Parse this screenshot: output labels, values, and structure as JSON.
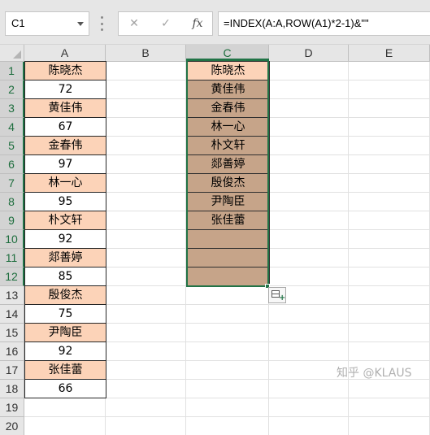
{
  "name_box": {
    "value": "C1"
  },
  "formula_bar": {
    "cancel_icon": "✕",
    "enter_icon": "✓",
    "fx_label": "fx",
    "formula": "=INDEX(A:A,ROW(A1)*2-1)&\"\""
  },
  "columns": [
    "A",
    "B",
    "C",
    "D",
    "E"
  ],
  "rows": [
    "1",
    "2",
    "3",
    "4",
    "5",
    "6",
    "7",
    "8",
    "9",
    "10",
    "11",
    "12",
    "13",
    "14",
    "15",
    "16",
    "17",
    "18",
    "19",
    "20"
  ],
  "column_a": [
    "陈晓杰",
    "72",
    "黄佳伟",
    "67",
    "金春伟",
    "97",
    "林一心",
    "95",
    "朴文轩",
    "92",
    "郯善婷",
    "85",
    "殷俊杰",
    "75",
    "尹陶臣",
    "92",
    "张佳蕾",
    "66"
  ],
  "column_c": [
    "陈晓杰",
    "黄佳伟",
    "金春伟",
    "林一心",
    "朴文轩",
    "郯善婷",
    "殷俊杰",
    "尹陶臣",
    "张佳蕾",
    "",
    "",
    ""
  ],
  "colors": {
    "name_fill": "#fcd3b8",
    "result_fill": "#c6a489",
    "selection": "#217346"
  },
  "watermark": "知乎 @KLAUS"
}
